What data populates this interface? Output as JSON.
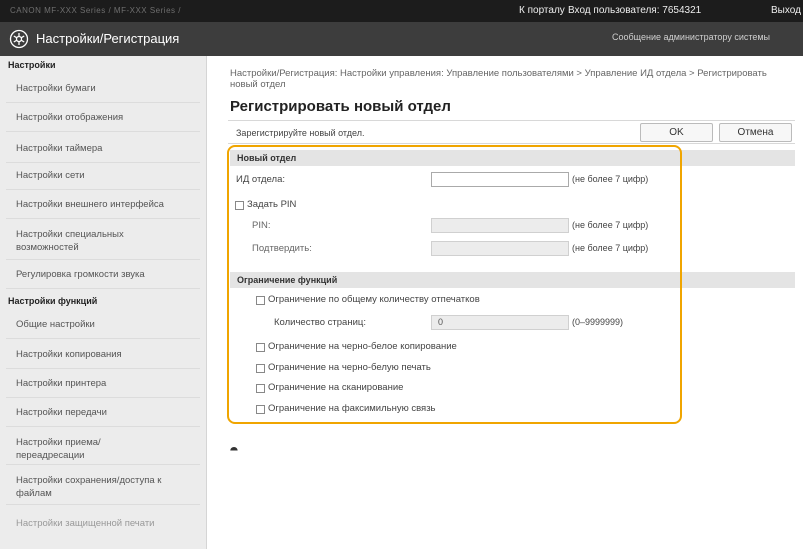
{
  "topbar": {
    "device": "CANON  MF-XXX Series / MF-XXX Series /",
    "portal_link": "К порталу",
    "login_label": "Вход пользователя:  7654321",
    "logout_link": "Выход"
  },
  "titlebar": {
    "app_title": "Настройки/Регистрация",
    "admin_link": "Сообщение администратору системы"
  },
  "sidebar": {
    "section1": "Настройки",
    "items1": [
      "Настройки бумаги",
      "Настройки отображения",
      "Настройки таймера",
      "Настройки сети",
      "Настройки внешнего интерфейса",
      "Настройки специальных возможностей",
      "Регулировка громкости звука"
    ],
    "section2": "Настройки функций",
    "items2": [
      "Общие настройки",
      "Настройки копирования",
      "Настройки принтера",
      "Настройки передачи",
      "Настройки приема/переадресации",
      "Настройки сохранения/доступа к файлам",
      "Настройки защищенной печати"
    ]
  },
  "main": {
    "breadcrumb": "Настройки/Регистрация: Настройки управления: Управление пользователями > Управление ИД отдела > Регистрировать новый отдел",
    "title": "Регистрировать новый отдел",
    "info_msg": "Зарегистрируйте новый отдел.",
    "ok_label": "OK",
    "cancel_label": "Отмена",
    "section_new": "Новый отдел",
    "dept_id_label": "ИД отдела:",
    "dept_id_value": "",
    "dept_id_hint": "(не более 7 цифр)",
    "set_pin_label": "Задать PIN",
    "pin_label": "PIN:",
    "pin_hint": "(не более 7 цифр)",
    "confirm_label": "Подтвердить:",
    "confirm_hint": "(не более 7 цифр)",
    "section_limits": "Ограничение функций",
    "limit_total": "Ограничение по общему количеству отпечатков",
    "pages_label": "Количество страниц:",
    "pages_value": "0",
    "pages_range": "(0–9999999)",
    "limit_bw_copy": "Ограничение на черно-белое копирование",
    "limit_bw_print": "Ограничение на черно-белую печать",
    "limit_scan": "Ограничение на сканирование",
    "limit_fax": "Ограничение на факсимильную связь",
    "top_arrow": "⯊"
  },
  "colors": {
    "highlight": "#f0a500",
    "titlebar": "#3d3d3d",
    "topbar": "#1c1c1c"
  }
}
